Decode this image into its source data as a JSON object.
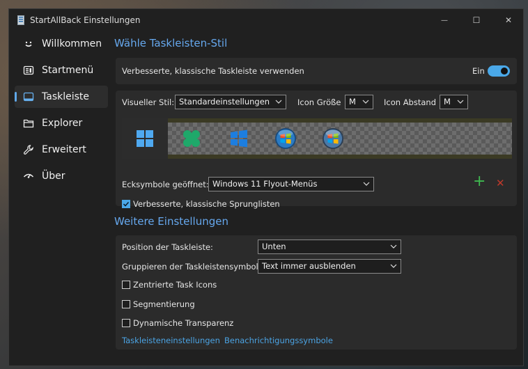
{
  "window": {
    "title": "StartAllBack Einstellungen",
    "minimize_glyph": "—",
    "maximize_glyph": "☐",
    "close_glyph": "✕"
  },
  "sidebar": {
    "items": [
      {
        "label": "Willkommen",
        "icon": "smile-icon"
      },
      {
        "label": "Startmenü",
        "icon": "start-menu-icon"
      },
      {
        "label": "Taskleiste",
        "icon": "taskbar-icon",
        "active": true
      },
      {
        "label": "Explorer",
        "icon": "folder-icon"
      },
      {
        "label": "Erweitert",
        "icon": "wrench-icon"
      },
      {
        "label": "Über",
        "icon": "about-icon"
      }
    ]
  },
  "taskbar_style": {
    "section_title": "Wähle Taskleisten-Stil",
    "enhanced_label": "Verbesserte, klassische Taskleiste verwenden",
    "toggle_state": "Ein",
    "visual_style_label": "Visueller Stil:",
    "visual_style_value": "Standardeinstellungen",
    "icon_size_label": "Icon Größe",
    "icon_size_value": "M",
    "icon_spacing_label": "Icon Abstand",
    "icon_spacing_value": "M",
    "corner_icons_label": "Ecksymbole geöffnet:",
    "corner_icons_value": "Windows 11 Flyout-Menüs",
    "jumplists_label": "Verbesserte, klassische Sprunglisten",
    "jumplists_checked": true,
    "add_glyph": "+",
    "remove_glyph": "✕"
  },
  "more_settings": {
    "section_title": "Weitere Einstellungen",
    "position_label": "Position der Taskleiste:",
    "position_value": "Unten",
    "grouping_label": "Gruppieren der Taskleistensymbole:",
    "grouping_value": "Text immer ausblenden",
    "centered_label": "Zentrierte Task Icons",
    "segmentation_label": "Segmentierung",
    "transparency_label": "Dynamische Transparenz",
    "link_taskbar_settings": "Taskleisteneinstellungen",
    "link_notification_icons": "Benachrichtigungssymbole"
  },
  "colors": {
    "accent": "#4aa8e8",
    "section_title": "#66a8ee",
    "add": "#3fb950",
    "remove": "#c0392b"
  }
}
